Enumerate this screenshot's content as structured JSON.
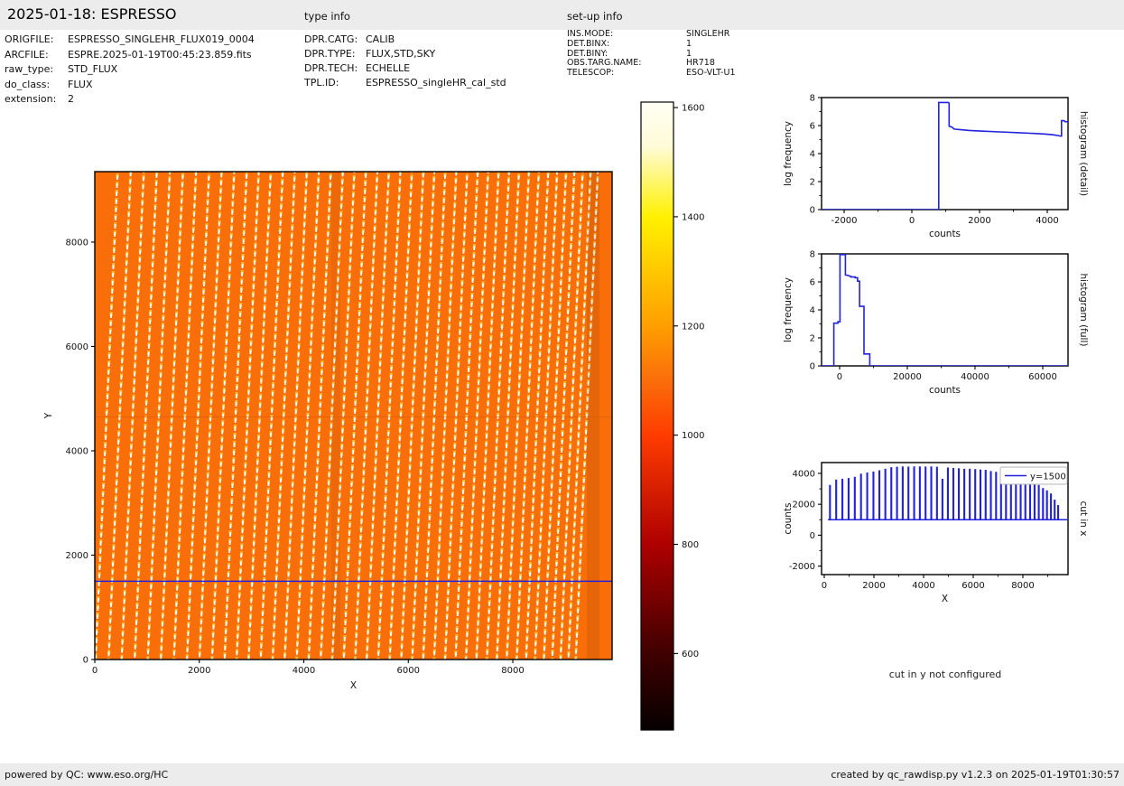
{
  "header": {
    "title": "2025-01-18: ESPRESSO",
    "type_info_label": "type info",
    "setup_info_label": "set-up info"
  },
  "file_info": {
    "rows": [
      {
        "label": "ORIGFILE:",
        "value": "ESPRESSO_SINGLEHR_FLUX019_0004"
      },
      {
        "label": "ARCFILE:",
        "value": "ESPRE.2025-01-19T00:45:23.859.fits"
      },
      {
        "label": "raw_type:",
        "value": "STD_FLUX"
      },
      {
        "label": "do_class:",
        "value": "FLUX"
      },
      {
        "label": "extension:",
        "value": "2"
      }
    ]
  },
  "type_info": {
    "rows": [
      {
        "label": "DPR.CATG:",
        "value": "CALIB"
      },
      {
        "label": "DPR.TYPE:",
        "value": "FLUX,STD,SKY"
      },
      {
        "label": "DPR.TECH:",
        "value": "ECHELLE"
      },
      {
        "label": "TPL.ID:",
        "value": "ESPRESSO_singleHR_cal_std"
      }
    ]
  },
  "setup_info": {
    "rows": [
      {
        "label": "INS.MODE:",
        "value": "SINGLEHR"
      },
      {
        "label": "DET.BINX:",
        "value": "1"
      },
      {
        "label": "DET.BINY:",
        "value": "1"
      },
      {
        "label": "OBS.TARG.NAME:",
        "value": "HR718"
      },
      {
        "label": "TELESCOP:",
        "value": "ESO-VLT-U1"
      }
    ]
  },
  "footer": {
    "left": "powered by QC: www.eso.org/HC",
    "right": "created by qc_rawdisp.py v1.2.3 on 2025-01-19T01:30:57"
  },
  "colors": {
    "line_blue": "#2222dd",
    "image_orange": "#fa6e0a",
    "stripe_white": "#ffffff",
    "stripe_yellow": "#ffc83d",
    "panel_gray": "#ececec",
    "seam_brown": "#d85a00"
  },
  "chart_data": {
    "cut_in_y_note": "cut in y not configured",
    "raw_image": {
      "type": "heatmap",
      "xlabel": "X",
      "ylabel": "Y",
      "xlim": [
        0,
        9900
      ],
      "ylim": [
        0,
        9350
      ],
      "xticks": [
        0,
        2000,
        4000,
        6000,
        8000
      ],
      "yticks": [
        0,
        2000,
        4000,
        6000,
        8000
      ],
      "background_value": 1050,
      "cut_line_y": 1500,
      "seam_y": 4650,
      "colormap": "hot",
      "description": "ESPRESSO raw echelle frame: orange background with ~44 slanted dashed spectral-order stripes, horizontal blue cut line at y=1500",
      "order_x": [
        230,
        480,
        730,
        980,
        1230,
        1480,
        1730,
        1980,
        2220,
        2460,
        2700,
        2930,
        3160,
        3390,
        3620,
        3850,
        4080,
        4310,
        4540,
        4760,
        4980,
        5200,
        5420,
        5640,
        5860,
        6080,
        6290,
        6500,
        6710,
        6920,
        7120,
        7320,
        7520,
        7720,
        7910,
        8100,
        8290,
        8470,
        8640,
        8810,
        8970,
        9130,
        9280,
        9420
      ]
    },
    "colorbar": {
      "type": "colorbar",
      "vmin": 460,
      "vmax": 1610,
      "ticks": [
        600,
        800,
        1000,
        1200,
        1400,
        1600
      ],
      "stops": [
        {
          "v": 460,
          "c": "#060000"
        },
        {
          "v": 600,
          "c": "#400000"
        },
        {
          "v": 800,
          "c": "#ae0000"
        },
        {
          "v": 1000,
          "c": "#ff3c00"
        },
        {
          "v": 1100,
          "c": "#fa6e0a"
        },
        {
          "v": 1200,
          "c": "#ff9e00"
        },
        {
          "v": 1400,
          "c": "#fff100"
        },
        {
          "v": 1530,
          "c": "#fffbd8"
        },
        {
          "v": 1610,
          "c": "#fffff4"
        }
      ]
    },
    "histogram_detail": {
      "type": "line",
      "xlabel": "counts",
      "ylabel": "log frequency",
      "right_label": "histogram (detail)",
      "xlim": [
        -2667,
        4613
      ],
      "ylim": [
        0,
        8
      ],
      "xticks": [
        -2000,
        0,
        2000,
        4000
      ],
      "yticks": [
        0,
        2,
        4,
        6,
        8
      ],
      "xminor": 1000,
      "yminor": 1,
      "points": [
        [
          -2667,
          0
        ],
        [
          795,
          0
        ],
        [
          795,
          7.65
        ],
        [
          1080,
          7.65
        ],
        [
          1100,
          7.6
        ],
        [
          1100,
          5.95
        ],
        [
          1180,
          5.9
        ],
        [
          1250,
          5.75
        ],
        [
          1450,
          5.7
        ],
        [
          1700,
          5.65
        ],
        [
          2100,
          5.6
        ],
        [
          2600,
          5.55
        ],
        [
          3100,
          5.5
        ],
        [
          3500,
          5.45
        ],
        [
          3900,
          5.4
        ],
        [
          4150,
          5.35
        ],
        [
          4300,
          5.3
        ],
        [
          4380,
          5.25
        ],
        [
          4420,
          5.25
        ],
        [
          4420,
          6.35
        ],
        [
          4500,
          6.35
        ],
        [
          4520,
          6.28
        ],
        [
          4613,
          6.28
        ]
      ]
    },
    "histogram_full": {
      "type": "line",
      "xlabel": "counts",
      "ylabel": "log frequency",
      "right_label": "histogram (full)",
      "xlim": [
        -5333,
        67467
      ],
      "ylim": [
        0,
        8
      ],
      "xticks": [
        0,
        20000,
        40000,
        60000
      ],
      "yticks": [
        0,
        2,
        4,
        6,
        8
      ],
      "xminor": 10000,
      "yminor": 1,
      "points": [
        [
          -5333,
          0
        ],
        [
          -1700,
          0
        ],
        [
          -1700,
          3.05
        ],
        [
          -500,
          3.05
        ],
        [
          -500,
          3.15
        ],
        [
          100,
          3.15
        ],
        [
          100,
          7.95
        ],
        [
          1700,
          7.95
        ],
        [
          1700,
          6.5
        ],
        [
          2600,
          6.45
        ],
        [
          3300,
          6.4
        ],
        [
          3300,
          6.35
        ],
        [
          4600,
          6.35
        ],
        [
          4600,
          6.3
        ],
        [
          5300,
          6.3
        ],
        [
          5300,
          6.05
        ],
        [
          5900,
          6.05
        ],
        [
          5900,
          4.25
        ],
        [
          7200,
          4.25
        ],
        [
          7200,
          0.85
        ],
        [
          8900,
          0.85
        ],
        [
          8900,
          0
        ],
        [
          67467,
          0
        ]
      ]
    },
    "cut_in_x": {
      "type": "spikes",
      "xlabel": "X",
      "ylabel": "counts",
      "right_label": "cut in x",
      "legend_label": "y=1500",
      "xlim": [
        -109,
        9818
      ],
      "ylim": [
        -2550,
        4700
      ],
      "xticks": [
        0,
        2000,
        4000,
        6000,
        8000
      ],
      "yticks": [
        -2000,
        0,
        2000,
        4000
      ],
      "xminor": 1000,
      "yminor": 1000,
      "baseline": 1000,
      "baseline_range": [
        150,
        9818
      ],
      "spikes": [
        [
          230,
          3250
        ],
        [
          480,
          3600
        ],
        [
          730,
          3650
        ],
        [
          980,
          3700
        ],
        [
          1230,
          3780
        ],
        [
          1480,
          3980
        ],
        [
          1730,
          4060
        ],
        [
          1980,
          4120
        ],
        [
          2220,
          4200
        ],
        [
          2460,
          4300
        ],
        [
          2700,
          4400
        ],
        [
          2930,
          4430
        ],
        [
          3160,
          4450
        ],
        [
          3390,
          4440
        ],
        [
          3620,
          4450
        ],
        [
          3850,
          4450
        ],
        [
          4080,
          4440
        ],
        [
          4310,
          4450
        ],
        [
          4540,
          4430
        ],
        [
          4760,
          3650
        ],
        [
          4980,
          4380
        ],
        [
          5200,
          4350
        ],
        [
          5420,
          4330
        ],
        [
          5640,
          4300
        ],
        [
          5860,
          4300
        ],
        [
          6080,
          4280
        ],
        [
          6290,
          4250
        ],
        [
          6500,
          4230
        ],
        [
          6710,
          4150
        ],
        [
          6920,
          4100
        ],
        [
          7120,
          4230
        ],
        [
          7320,
          4100
        ],
        [
          7520,
          3950
        ],
        [
          7720,
          3900
        ],
        [
          7910,
          3750
        ],
        [
          8100,
          3600
        ],
        [
          8290,
          3450
        ],
        [
          8470,
          3300
        ],
        [
          8640,
          3250
        ],
        [
          8810,
          3050
        ],
        [
          8970,
          2900
        ],
        [
          9130,
          2700
        ],
        [
          9280,
          2300
        ],
        [
          9420,
          1950
        ]
      ]
    }
  }
}
